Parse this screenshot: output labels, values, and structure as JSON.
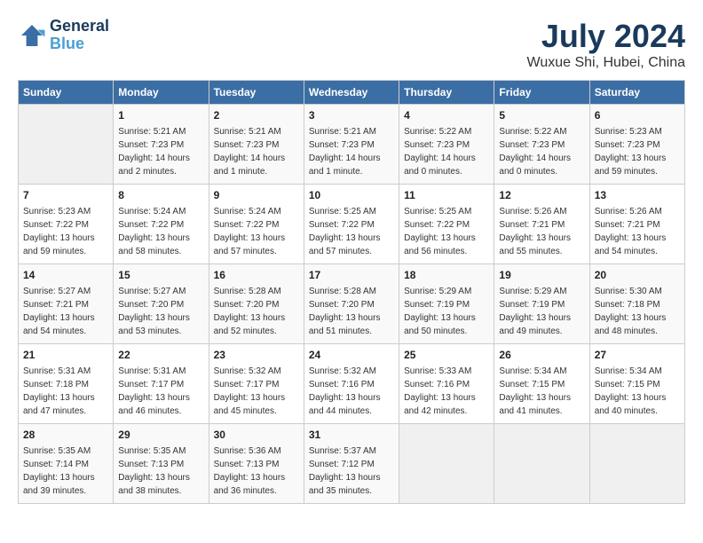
{
  "logo": {
    "line1": "General",
    "line2": "Blue"
  },
  "title": "July 2024",
  "subtitle": "Wuxue Shi, Hubei, China",
  "days_of_week": [
    "Sunday",
    "Monday",
    "Tuesday",
    "Wednesday",
    "Thursday",
    "Friday",
    "Saturday"
  ],
  "weeks": [
    [
      {
        "day": "",
        "info": ""
      },
      {
        "day": "1",
        "info": "Sunrise: 5:21 AM\nSunset: 7:23 PM\nDaylight: 14 hours\nand 2 minutes."
      },
      {
        "day": "2",
        "info": "Sunrise: 5:21 AM\nSunset: 7:23 PM\nDaylight: 14 hours\nand 1 minute."
      },
      {
        "day": "3",
        "info": "Sunrise: 5:21 AM\nSunset: 7:23 PM\nDaylight: 14 hours\nand 1 minute."
      },
      {
        "day": "4",
        "info": "Sunrise: 5:22 AM\nSunset: 7:23 PM\nDaylight: 14 hours\nand 0 minutes."
      },
      {
        "day": "5",
        "info": "Sunrise: 5:22 AM\nSunset: 7:23 PM\nDaylight: 14 hours\nand 0 minutes."
      },
      {
        "day": "6",
        "info": "Sunrise: 5:23 AM\nSunset: 7:23 PM\nDaylight: 13 hours\nand 59 minutes."
      }
    ],
    [
      {
        "day": "7",
        "info": "Sunrise: 5:23 AM\nSunset: 7:22 PM\nDaylight: 13 hours\nand 59 minutes."
      },
      {
        "day": "8",
        "info": "Sunrise: 5:24 AM\nSunset: 7:22 PM\nDaylight: 13 hours\nand 58 minutes."
      },
      {
        "day": "9",
        "info": "Sunrise: 5:24 AM\nSunset: 7:22 PM\nDaylight: 13 hours\nand 57 minutes."
      },
      {
        "day": "10",
        "info": "Sunrise: 5:25 AM\nSunset: 7:22 PM\nDaylight: 13 hours\nand 57 minutes."
      },
      {
        "day": "11",
        "info": "Sunrise: 5:25 AM\nSunset: 7:22 PM\nDaylight: 13 hours\nand 56 minutes."
      },
      {
        "day": "12",
        "info": "Sunrise: 5:26 AM\nSunset: 7:21 PM\nDaylight: 13 hours\nand 55 minutes."
      },
      {
        "day": "13",
        "info": "Sunrise: 5:26 AM\nSunset: 7:21 PM\nDaylight: 13 hours\nand 54 minutes."
      }
    ],
    [
      {
        "day": "14",
        "info": "Sunrise: 5:27 AM\nSunset: 7:21 PM\nDaylight: 13 hours\nand 54 minutes."
      },
      {
        "day": "15",
        "info": "Sunrise: 5:27 AM\nSunset: 7:20 PM\nDaylight: 13 hours\nand 53 minutes."
      },
      {
        "day": "16",
        "info": "Sunrise: 5:28 AM\nSunset: 7:20 PM\nDaylight: 13 hours\nand 52 minutes."
      },
      {
        "day": "17",
        "info": "Sunrise: 5:28 AM\nSunset: 7:20 PM\nDaylight: 13 hours\nand 51 minutes."
      },
      {
        "day": "18",
        "info": "Sunrise: 5:29 AM\nSunset: 7:19 PM\nDaylight: 13 hours\nand 50 minutes."
      },
      {
        "day": "19",
        "info": "Sunrise: 5:29 AM\nSunset: 7:19 PM\nDaylight: 13 hours\nand 49 minutes."
      },
      {
        "day": "20",
        "info": "Sunrise: 5:30 AM\nSunset: 7:18 PM\nDaylight: 13 hours\nand 48 minutes."
      }
    ],
    [
      {
        "day": "21",
        "info": "Sunrise: 5:31 AM\nSunset: 7:18 PM\nDaylight: 13 hours\nand 47 minutes."
      },
      {
        "day": "22",
        "info": "Sunrise: 5:31 AM\nSunset: 7:17 PM\nDaylight: 13 hours\nand 46 minutes."
      },
      {
        "day": "23",
        "info": "Sunrise: 5:32 AM\nSunset: 7:17 PM\nDaylight: 13 hours\nand 45 minutes."
      },
      {
        "day": "24",
        "info": "Sunrise: 5:32 AM\nSunset: 7:16 PM\nDaylight: 13 hours\nand 44 minutes."
      },
      {
        "day": "25",
        "info": "Sunrise: 5:33 AM\nSunset: 7:16 PM\nDaylight: 13 hours\nand 42 minutes."
      },
      {
        "day": "26",
        "info": "Sunrise: 5:34 AM\nSunset: 7:15 PM\nDaylight: 13 hours\nand 41 minutes."
      },
      {
        "day": "27",
        "info": "Sunrise: 5:34 AM\nSunset: 7:15 PM\nDaylight: 13 hours\nand 40 minutes."
      }
    ],
    [
      {
        "day": "28",
        "info": "Sunrise: 5:35 AM\nSunset: 7:14 PM\nDaylight: 13 hours\nand 39 minutes."
      },
      {
        "day": "29",
        "info": "Sunrise: 5:35 AM\nSunset: 7:13 PM\nDaylight: 13 hours\nand 38 minutes."
      },
      {
        "day": "30",
        "info": "Sunrise: 5:36 AM\nSunset: 7:13 PM\nDaylight: 13 hours\nand 36 minutes."
      },
      {
        "day": "31",
        "info": "Sunrise: 5:37 AM\nSunset: 7:12 PM\nDaylight: 13 hours\nand 35 minutes."
      },
      {
        "day": "",
        "info": ""
      },
      {
        "day": "",
        "info": ""
      },
      {
        "day": "",
        "info": ""
      }
    ]
  ]
}
